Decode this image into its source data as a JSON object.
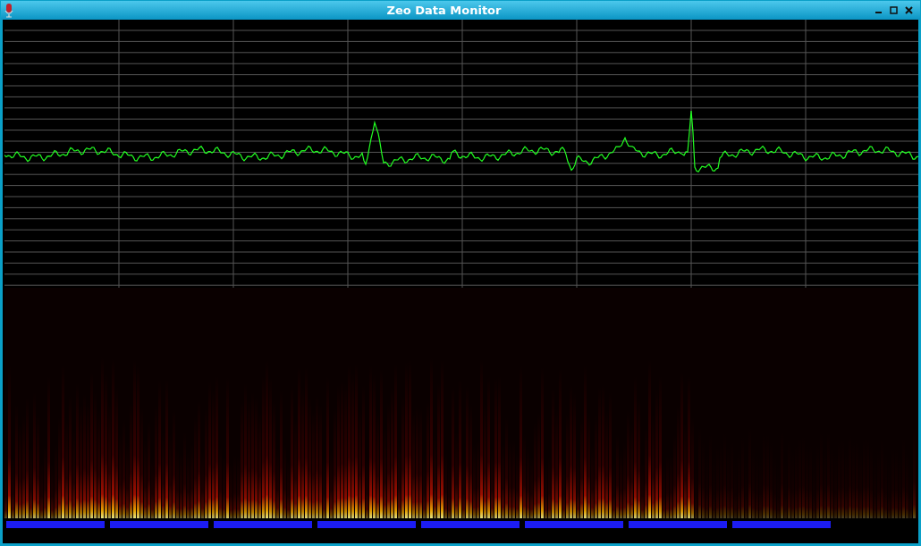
{
  "window": {
    "title": "Zeo Data Monitor"
  }
}
